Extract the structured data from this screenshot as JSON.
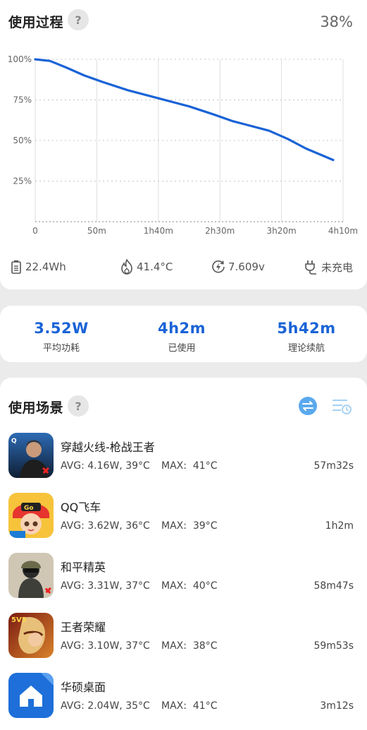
{
  "usage": {
    "title": "使用过程",
    "help_icon": "?",
    "battery_percent": "38%"
  },
  "chart_data": {
    "type": "line",
    "x_ticks": [
      "0",
      "50m",
      "1h40m",
      "2h30m",
      "3h20m",
      "4h10m"
    ],
    "y_ticks": [
      "100%",
      "75%",
      "50%",
      "25%"
    ],
    "ylim": [
      0,
      100
    ],
    "xlim_minutes": [
      0,
      250
    ],
    "grid": true,
    "color": "#1a63d6",
    "series": [
      {
        "x": [
          0,
          12,
          25,
          40,
          55,
          75,
          100,
          125,
          145,
          160,
          170,
          180,
          190,
          205,
          220,
          242
        ],
        "y": [
          100,
          99,
          95,
          90,
          86,
          81,
          76,
          71,
          66,
          62,
          60,
          58,
          56,
          51,
          45,
          38
        ]
      }
    ]
  },
  "info": {
    "capacity": "22.4Wh",
    "temperature": "41.4°C",
    "voltage": "7.609v",
    "charging": "未充电"
  },
  "stats": [
    {
      "value": "3.52W",
      "label": "平均功耗"
    },
    {
      "value": "4h2m",
      "label": "已使用"
    },
    {
      "value": "5h42m",
      "label": "理论续航"
    }
  ],
  "scenes": {
    "title": "使用场景",
    "help_icon": "?",
    "max_label": "MAX:",
    "apps": [
      {
        "name": "穿越火线-枪战王者",
        "avg": "AVG: 4.16W, 39°C",
        "max": "41°C",
        "time": "57m32s",
        "icon": "cf-game-icon"
      },
      {
        "name": "QQ飞车",
        "avg": "AVG: 3.62W, 36°C",
        "max": "39°C",
        "time": "1h2m",
        "icon": "qq-speed-icon"
      },
      {
        "name": "和平精英",
        "avg": "AVG: 3.31W, 37°C",
        "max": "40°C",
        "time": "58m47s",
        "icon": "peace-elite-icon"
      },
      {
        "name": "王者荣耀",
        "avg": "AVG: 3.10W, 37°C",
        "max": "38°C",
        "time": "59m53s",
        "icon": "honor-of-kings-icon"
      },
      {
        "name": "华硕桌面",
        "avg": "AVG: 2.04W, 35°C",
        "max": "41°C",
        "time": "3m12s",
        "icon": "asus-launcher-icon"
      }
    ]
  }
}
